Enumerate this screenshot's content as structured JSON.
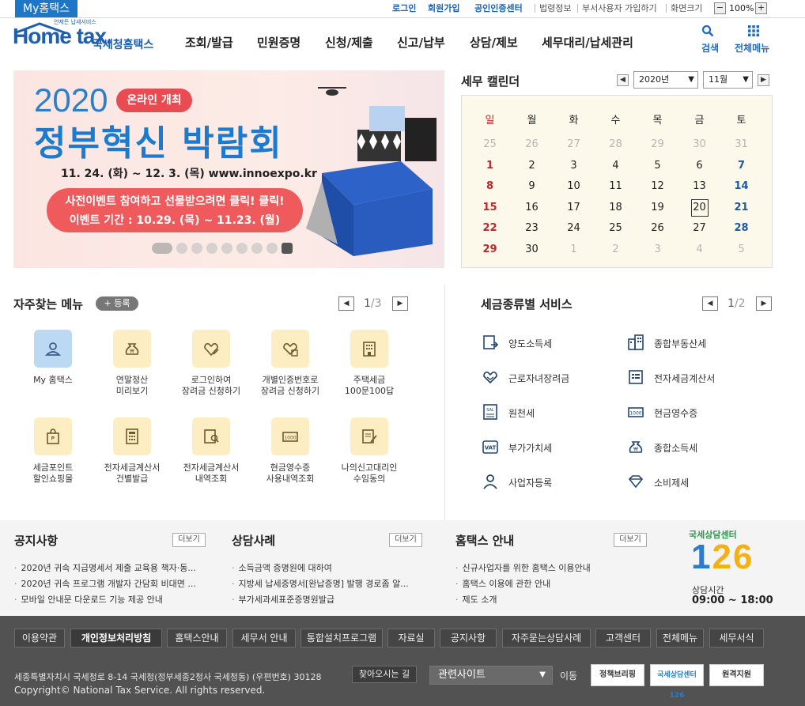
{
  "topbar": {
    "myhome_tab": "My홈택스",
    "links": [
      "로그인",
      "회원가입",
      "공인인증센터",
      "법령정보",
      "부서사용자 가입하기",
      "화면크기"
    ],
    "zoom": "100%",
    "zoom_minus": "−",
    "zoom_plus": "+"
  },
  "header": {
    "logo_main": "Home tax.",
    "logo_small": "언제든 납세서비스",
    "logo_sub": "국세청홈택스",
    "nav": [
      "조회/발급",
      "민원증명",
      "신청/제출",
      "신고/납부",
      "상담/제보",
      "세무대리/납세관리"
    ],
    "search_label": "검색",
    "allmenu_label": "전체메뉴"
  },
  "banner": {
    "year": "2020",
    "pill": "온라인 개최",
    "title": "정부혁신 박람회",
    "date_url": "11. 24. (화) ~ 12. 3. (목)   www.innoexpo.kr",
    "event_line1": "사전이벤트 참여하고 선물받으려면 클릭! 클릭!",
    "event_line2": "이벤트 기간 : 10.29. (목) ~ 11.23. (월)",
    "slides": 9
  },
  "calendar": {
    "title": "세무 캘린더",
    "year_select": "2020년",
    "month_select": "11월",
    "weekdays": [
      "일",
      "월",
      "화",
      "수",
      "목",
      "금",
      "토"
    ],
    "rows": [
      [
        "25",
        "26",
        "27",
        "28",
        "29",
        "30",
        "31"
      ],
      [
        "1",
        "2",
        "3",
        "4",
        "5",
        "6",
        "7"
      ],
      [
        "8",
        "9",
        "10",
        "11",
        "12",
        "13",
        "14"
      ],
      [
        "15",
        "16",
        "17",
        "18",
        "19",
        "20",
        "21"
      ],
      [
        "22",
        "23",
        "24",
        "25",
        "26",
        "27",
        "28"
      ],
      [
        "29",
        "30",
        "1",
        "2",
        "3",
        "4",
        "5"
      ]
    ],
    "today": "20",
    "colors": {
      "sunday": "#c0272d",
      "saturday": "#1a5aa8",
      "other_month": "#b5b5b5",
      "background": "#fdf9ea"
    }
  },
  "frequent": {
    "title": "자주찾는 메뉴",
    "register": "+ 등록",
    "page": "1",
    "total": "3",
    "items": [
      {
        "label": "My 홈택스",
        "icon": "user-icon",
        "highlight": true
      },
      {
        "label": "연말정산\n미리보기",
        "icon": "money-bag-icon"
      },
      {
        "label": "로그인하여\n장려금 신청하기",
        "icon": "heart-pen-icon"
      },
      {
        "label": "개별인증번호로\n장려금 신청하기",
        "icon": "heart-doc-icon"
      },
      {
        "label": "주택세금\n100문100답",
        "icon": "building-icon"
      },
      {
        "label": "세금포인트\n할인쇼핑몰",
        "icon": "shopping-bag-icon"
      },
      {
        "label": "전자세금계산서\n건별발급",
        "icon": "calculator-icon"
      },
      {
        "label": "전자세금계산서\n내역조회",
        "icon": "invoice-search-icon"
      },
      {
        "label": "현금영수증\n사용내역조회",
        "icon": "cash-receipt-icon"
      },
      {
        "label": "나의신고대리인\n수임동의",
        "icon": "document-pen-icon"
      }
    ]
  },
  "tax_service": {
    "title": "세금종류별 서비스",
    "page": "1",
    "total": "2",
    "items": [
      {
        "label": "양도소득세",
        "icon": "transfer-doc-icon"
      },
      {
        "label": "종합부동산세",
        "icon": "buildings-icon"
      },
      {
        "label": "근로자녀장려금",
        "icon": "heart-hands-icon"
      },
      {
        "label": "전자세금계산서",
        "icon": "invoice-icon"
      },
      {
        "label": "원천세",
        "icon": "salary-doc-icon"
      },
      {
        "label": "현금영수증",
        "icon": "banknote-icon"
      },
      {
        "label": "부가가치세",
        "icon": "vat-icon"
      },
      {
        "label": "종합소득세",
        "icon": "money-bag-icon"
      },
      {
        "label": "사업자등록",
        "icon": "person-icon"
      },
      {
        "label": "소비제세",
        "icon": "diamond-icon"
      }
    ]
  },
  "notices": [
    {
      "title": "공지사항",
      "more": "더보기",
      "items": [
        "2020년 귀속 지급명세서 제출 교육용 책자·동...",
        "2020년 귀속 프로그램 개발자 간담회 비대면 ...",
        "모바일 안내문 다운로드 기능 제공 안내"
      ]
    },
    {
      "title": "상담사례",
      "more": "더보기",
      "items": [
        "소득금액 증명원에 대하여",
        "지방세 납세증명서[완납증명] 발행 경로좀 알...",
        "부가세과세표준증명원발급"
      ]
    },
    {
      "title": "홈택스 안내",
      "more": "더보기",
      "items": [
        "신규사업자를 위한 홈택스 이용안내",
        "홈택스 이용에 관한 안내",
        "제도 소개"
      ]
    }
  ],
  "center126": {
    "top": "국세상담센터",
    "number_one": "1",
    "number_rest": "26",
    "hours_label": "상담시간",
    "hours": "09:00 ~ 18:00"
  },
  "footer": {
    "links": [
      "이용약관",
      "개인정보처리방침",
      "홈택스안내",
      "세무서 안내",
      "통합설치프로그램",
      "자료실",
      "공지사항",
      "자주묻는상담사례",
      "고객센터",
      "전체메뉴",
      "세무서식"
    ],
    "address": "세종특별자치시 국세청로 8-14 국세청(정부세종2청사 국세청동) (우편번호) 30128",
    "map_button": "찾아오시는 길",
    "related_site": "관련사이트",
    "go": "이동",
    "badges": [
      "정책브리핑",
      "국세상담센터 126",
      "원격지원"
    ],
    "copyright": "Copyright© National Tax Service. All rights reserved."
  }
}
